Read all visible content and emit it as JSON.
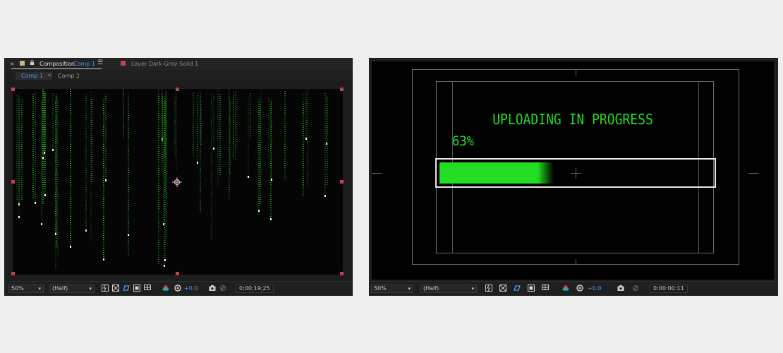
{
  "left_panel": {
    "header": {
      "close_glyph": "×",
      "composition_label": "Composition",
      "comp_name": "Comp 1",
      "menu_glyph": "☰",
      "layer_label": "Layer  Dark Gray Solid 1",
      "swatch_color": "#c9b28a",
      "layer_swatch_color": "#c0434a"
    },
    "tabs": [
      {
        "label": "Comp 1",
        "active": true
      },
      {
        "label": "Comp 2",
        "active": false
      }
    ],
    "tab_separator": "<",
    "footer": {
      "zoom": "50%",
      "resolution": "(Half)",
      "exposure": "+0.0",
      "timecode": "0;00;19;25"
    },
    "icons": [
      "toggle-transparency-icon",
      "grid-icon",
      "mask-visibility-icon",
      "region-of-interest-icon",
      "channel-icon",
      "color-management-icon",
      "exposure-reset-icon",
      "snapshot-icon",
      "show-snapshot-icon"
    ]
  },
  "right_panel": {
    "title_text": "UPLOADING IN PROGRESS",
    "percent_text": "63%",
    "progress": 0.42,
    "accent_color": "#22dd22",
    "footer": {
      "zoom": "50%",
      "resolution": "(Half)",
      "exposure": "+0.0",
      "timecode": "0:00:00:11"
    }
  }
}
